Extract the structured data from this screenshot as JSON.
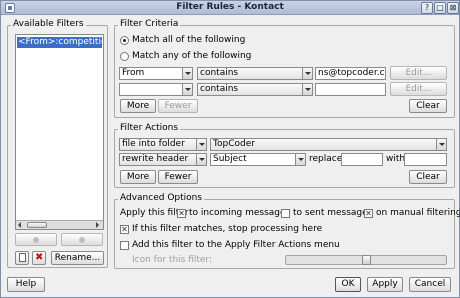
{
  "window": {
    "title": "Filter Rules - Kontact",
    "controls": [
      "?",
      "□",
      "⊠"
    ]
  },
  "available_filters": {
    "title": "Available Filters",
    "items": [
      "<From>:competitions@"
    ],
    "rename_label": "Rename..."
  },
  "criteria": {
    "title": "Filter Criteria",
    "match_all": "Match all of the following",
    "match_any": "Match any of the following",
    "selected_mode": "all",
    "rows": [
      {
        "field": "From",
        "op": "contains",
        "value": "ns@topcoder.com",
        "edit": "Edit..."
      },
      {
        "field": "",
        "op": "contains",
        "value": "",
        "edit": "Edit..."
      }
    ],
    "more": "More",
    "fewer": "Fewer",
    "clear": "Clear"
  },
  "actions": {
    "title": "Filter Actions",
    "rows": [
      {
        "action": "file into folder",
        "target": "TopCoder"
      },
      {
        "action": "rewrite header",
        "header": "Subject",
        "replace_label": "replace",
        "replace_value": "",
        "with_label": "with",
        "with_value": ""
      }
    ],
    "more": "More",
    "fewer": "Fewer",
    "clear": "Clear"
  },
  "advanced": {
    "title": "Advanced Options",
    "apply_prefix": "Apply this filter",
    "incoming": {
      "label": "to incoming messages",
      "checked": true
    },
    "sent": {
      "label": "to sent messages",
      "checked": false
    },
    "manual": {
      "label": "on manual filtering",
      "checked": true
    },
    "stop": {
      "label": "If this filter matches, stop processing here",
      "checked": true
    },
    "apply_actions_menu": {
      "label": "Add this filter to the Apply Filter Actions menu",
      "checked": false
    },
    "icon_label": "Icon for this filter:",
    "icon_slider_value": 0.5
  },
  "footer": {
    "help": "Help",
    "ok": "OK",
    "apply": "Apply",
    "cancel": "Cancel"
  }
}
